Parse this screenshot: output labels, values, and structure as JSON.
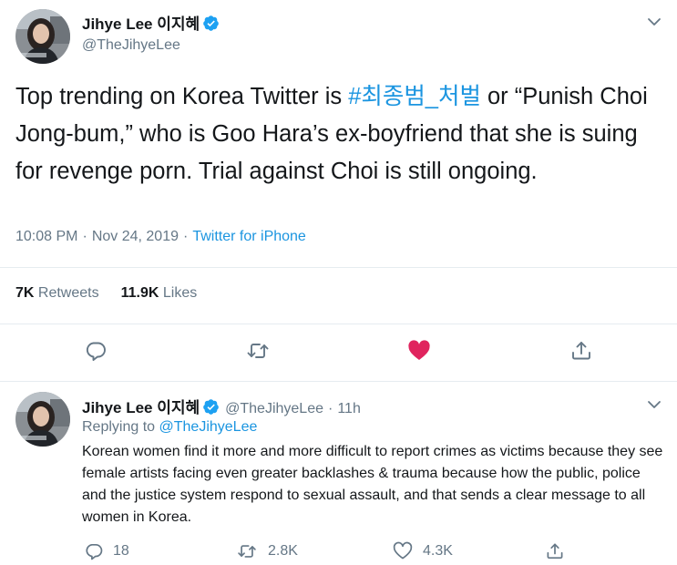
{
  "main_tweet": {
    "author_name": "Jihye Lee 이지혜",
    "handle": "@TheJihyeLee",
    "text_before": "Top trending on Korea Twitter is ",
    "hashtag": "#최종범_처벌",
    "text_after": " or “Punish Choi Jong-bum,” who is Goo Hara’s ex-boyfriend that she is suing for revenge porn. Trial against Choi is still ongoing.",
    "time": "10:08 PM",
    "date": "Nov 24, 2019",
    "source": "Twitter for iPhone",
    "retweets_count": "7K",
    "retweets_label": "Retweets",
    "likes_count": "11.9K",
    "likes_label": "Likes",
    "liked": true
  },
  "reply_tweet": {
    "author_name": "Jihye Lee 이지혜",
    "handle": "@TheJihyeLee",
    "age": "11h",
    "replying_to_label": "Replying to",
    "replying_to_handle": "@TheJihyeLee",
    "text": "Korean women find it more and more difficult to report crimes as victims because they see female artists facing even greater backlashes & trauma because how the public, police and the justice system respond to sexual assault, and that sends a clear message to all women in Korea.",
    "reply_count": "18",
    "retweet_count": "2.8K",
    "like_count": "4.3K"
  },
  "icons": {
    "verified": "verified-badge-icon",
    "caret": "chevron-down-icon",
    "reply": "reply-icon",
    "retweet": "retweet-icon",
    "like": "heart-icon",
    "share": "share-icon"
  },
  "colors": {
    "accent": "#1b95e0",
    "like_active": "#e0245e",
    "muted": "#657786",
    "text": "#14171a",
    "divider": "#e6ecf0"
  }
}
